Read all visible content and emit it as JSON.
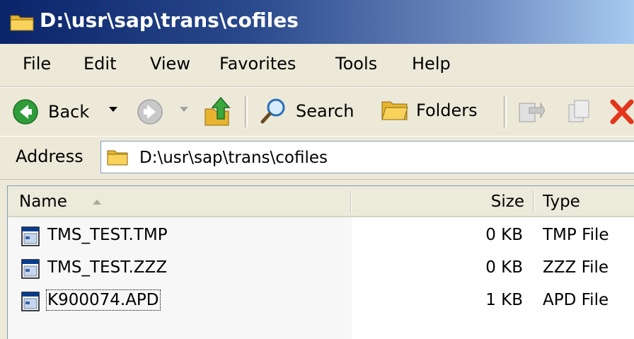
{
  "window": {
    "title": "D:\\usr\\sap\\trans\\cofiles"
  },
  "menu": {
    "items": [
      {
        "label": "File"
      },
      {
        "label": "Edit"
      },
      {
        "label": "View"
      },
      {
        "label": "Favorites"
      },
      {
        "label": "Tools"
      },
      {
        "label": "Help"
      }
    ]
  },
  "toolbar": {
    "back_label": "Back",
    "search_label": "Search",
    "folders_label": "Folders"
  },
  "address": {
    "label": "Address",
    "value": "D:\\usr\\sap\\trans\\cofiles"
  },
  "list": {
    "columns": {
      "name": "Name",
      "size": "Size",
      "type": "Type"
    },
    "sort_column": "name",
    "rows": [
      {
        "name": "TMS_TEST.TMP",
        "size": "0 KB",
        "type": "TMP File"
      },
      {
        "name": "TMS_TEST.ZZZ",
        "size": "0 KB",
        "type": "ZZZ File"
      },
      {
        "name": "K900074.APD",
        "size": "1 KB",
        "type": "APD File"
      }
    ]
  },
  "colors": {
    "title_gradient_start": "#0a246a",
    "title_gradient_end": "#a6caf0",
    "chrome": "#ece9d8",
    "back_arrow": "#2f9d3a",
    "delete_x": "#e2361c",
    "folder": "#f5c542"
  }
}
